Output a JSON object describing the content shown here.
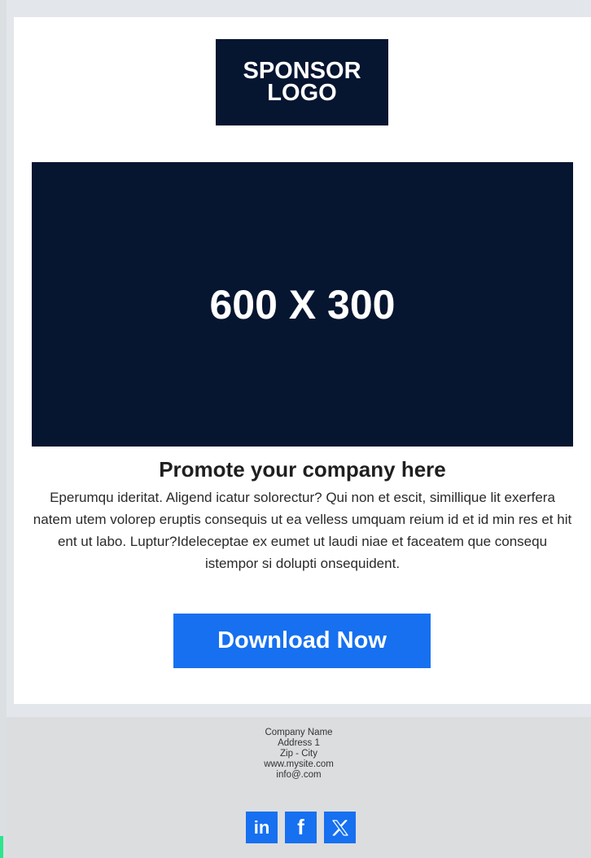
{
  "logo": {
    "line1": "SPONSOR",
    "line2": "LOGO"
  },
  "hero": {
    "label": "600 X 300"
  },
  "content": {
    "headline": "Promote your company here",
    "body": "Eperumqu ideritat. Aligend icatur solorectur? Qui non et escit, simillique lit exerfera natem utem volorep eruptis consequis ut ea velless umquam reium id et id min res et hit ent ut labo. Luptur?Ideleceptae ex eumet ut laudi niae et faceatem que consequ istempor si dolupti onsequident."
  },
  "cta": {
    "label": "Download Now"
  },
  "footer": {
    "company": "Company Name",
    "address": "Address 1",
    "zip_city": "Zip - City",
    "website": "www.mysite.com",
    "email": "info@.com"
  },
  "social": [
    {
      "icon": "linkedin-icon",
      "glyph": "in"
    },
    {
      "icon": "facebook-icon",
      "glyph": "f"
    },
    {
      "icon": "x-icon"
    }
  ],
  "colors": {
    "dark_navy": "#061530",
    "accent_blue": "#1670f0",
    "footer_gray": "#dcdddf"
  }
}
